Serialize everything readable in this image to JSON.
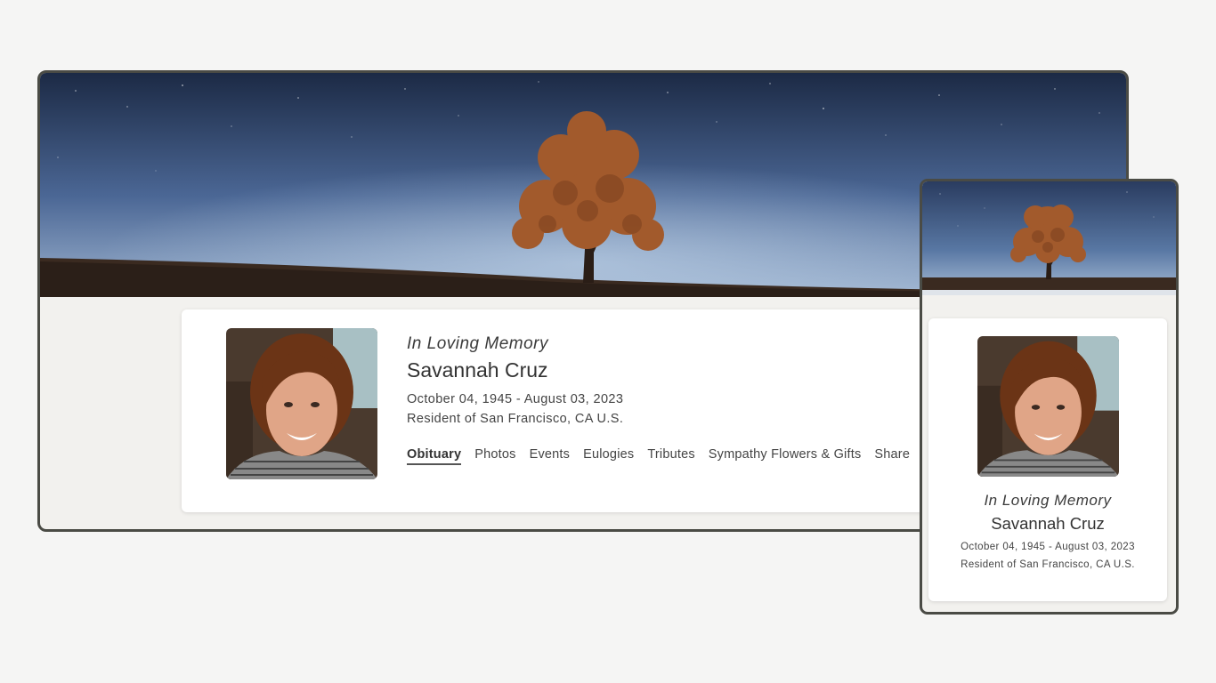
{
  "desktop": {
    "banner_icon": "tree-night-sky-banner",
    "memory_label": "In Loving Memory",
    "name": "Savannah Cruz",
    "dates": "October 04, 1945 - August 03, 2023",
    "residence": "Resident of San Francisco, CA U.S.",
    "tabs": [
      {
        "label": "Obituary",
        "active": true
      },
      {
        "label": "Photos",
        "active": false
      },
      {
        "label": "Events",
        "active": false
      },
      {
        "label": "Eulogies",
        "active": false
      },
      {
        "label": "Tributes",
        "active": false
      },
      {
        "label": "Sympathy Flowers & Gifts",
        "active": false
      },
      {
        "label": "Share",
        "active": false
      }
    ]
  },
  "mobile": {
    "banner_icon": "tree-night-sky-banner",
    "memory_label": "In Loving Memory",
    "name": "Savannah Cruz",
    "dates": "October 04, 1945 - August 03, 2023",
    "residence": "Resident of San Francisco, CA U.S."
  },
  "colors": {
    "frame_border": "#4a4b45",
    "page_background": "#f5f5f4",
    "sky_top": "#1c2a45",
    "sky_horizon": "#8ea7c8",
    "tree_foliage": "#a25a2c",
    "ground": "#3a2a20"
  }
}
